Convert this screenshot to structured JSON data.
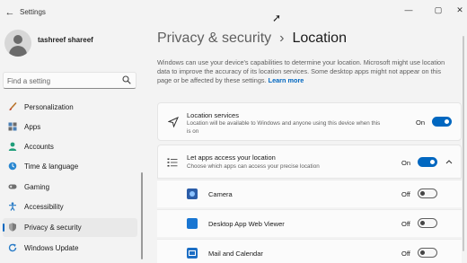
{
  "window": {
    "title": "Settings",
    "back_icon": "back-arrow-icon",
    "controls": [
      "minimize-icon",
      "maximize-icon",
      "close-icon"
    ]
  },
  "profile": {
    "name": "tashreef shareef"
  },
  "search": {
    "placeholder": "Find a setting",
    "icon": "search-icon"
  },
  "sidebar": {
    "items": [
      {
        "label": "Personalization",
        "icon": "brush-icon",
        "active": false
      },
      {
        "label": "Apps",
        "icon": "apps-icon",
        "active": false
      },
      {
        "label": "Accounts",
        "icon": "person-icon",
        "active": false
      },
      {
        "label": "Time & language",
        "icon": "globe-clock-icon",
        "active": false
      },
      {
        "label": "Gaming",
        "icon": "gamepad-icon",
        "active": false
      },
      {
        "label": "Accessibility",
        "icon": "accessibility-icon",
        "active": false
      },
      {
        "label": "Privacy & security",
        "icon": "shield-icon",
        "active": true
      },
      {
        "label": "Windows Update",
        "icon": "update-icon",
        "active": false
      }
    ]
  },
  "breadcrumb": {
    "parent": "Privacy & security",
    "separator": "›",
    "current": "Location"
  },
  "description": {
    "text": "Windows can use your device's capabilities to determine your location. Microsoft might use location data to improve the accuracy of its location services. Some desktop apps might not appear on this page or be affected by these settings.",
    "link": "Learn more"
  },
  "location_services": {
    "title": "Location services",
    "subtitle": "Location will be available to Windows and anyone using this device when this is on",
    "state": "On",
    "icon": "location-arrow-icon"
  },
  "let_apps": {
    "title": "Let apps access your location",
    "subtitle": "Choose which apps can access your precise location",
    "state": "On",
    "icon": "list-icon",
    "expand_icon": "chevron-up-icon"
  },
  "apps": [
    {
      "name": "Camera",
      "state": "Off",
      "icon": "camera-app-icon"
    },
    {
      "name": "Desktop App Web Viewer",
      "state": "Off",
      "icon": "web-viewer-app-icon"
    },
    {
      "name": "Mail and Calendar",
      "state": "Off",
      "icon": "mail-app-icon"
    }
  ],
  "colors": {
    "accent": "#0067c0",
    "background": "#f3f3f3",
    "card": "#fbfbfb"
  }
}
